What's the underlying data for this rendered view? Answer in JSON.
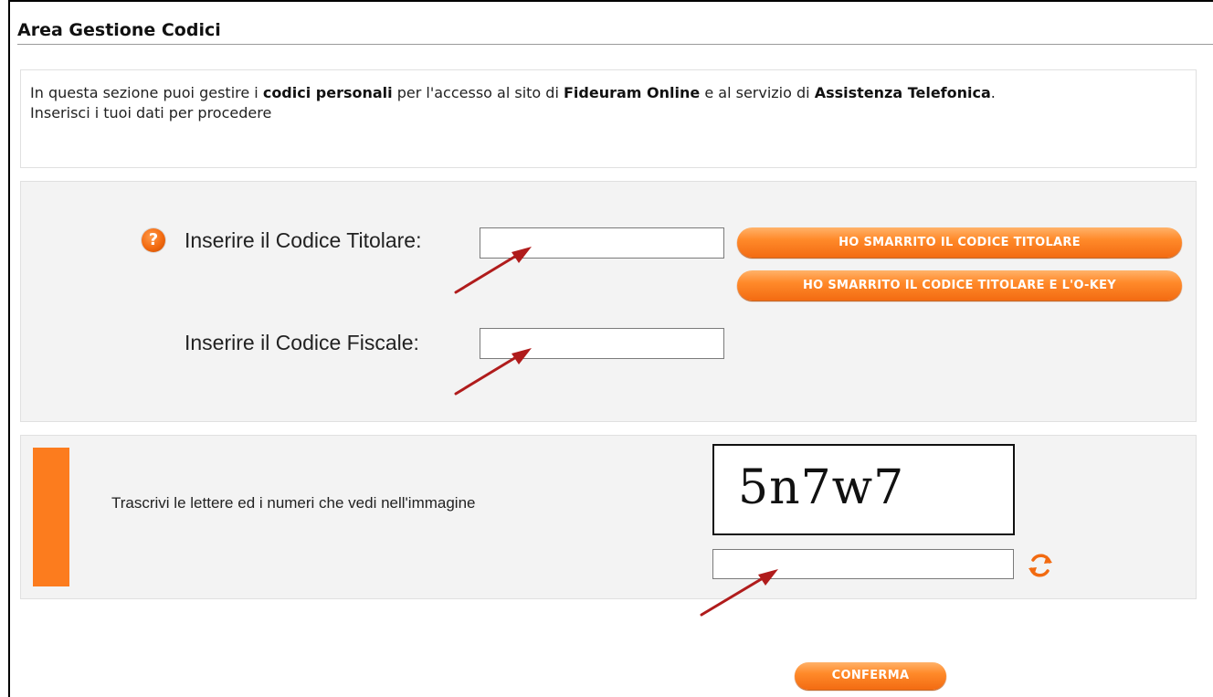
{
  "header": {
    "title": "Area Gestione Codici"
  },
  "intro": {
    "p1_a": "In questa sezione puoi gestire i ",
    "p1_b": "codici personali",
    "p1_c": " per l'accesso al sito di ",
    "p1_d": "Fideuram Online",
    "p1_e": " e al servizio di ",
    "p1_f": "Assistenza Telefonica",
    "p1_g": ".",
    "line2": "Inserisci i tuoi dati per procedere"
  },
  "form": {
    "titolare_label": "Inserire il Codice Titolare:",
    "titolare_value": "",
    "fiscale_label": "Inserire il Codice Fiscale:",
    "fiscale_value": "",
    "help_icon": "question-icon",
    "lost_code_button": "HO SMARRITO IL CODICE TITOLARE",
    "lost_code_okey_button": "HO SMARRITO IL CODICE TITOLARE E L'O-KEY"
  },
  "captcha": {
    "instruction": "Trascrivi le lettere ed i numeri che vedi nell'immagine",
    "image_text": "5n7w7",
    "input_value": "",
    "refresh_icon": "refresh-icon"
  },
  "actions": {
    "confirm_button": "CONFERMA"
  },
  "colors": {
    "accent": "#fc7c1e",
    "panel_bg": "#f3f3f3",
    "annotation_arrow": "#b01c1c"
  }
}
